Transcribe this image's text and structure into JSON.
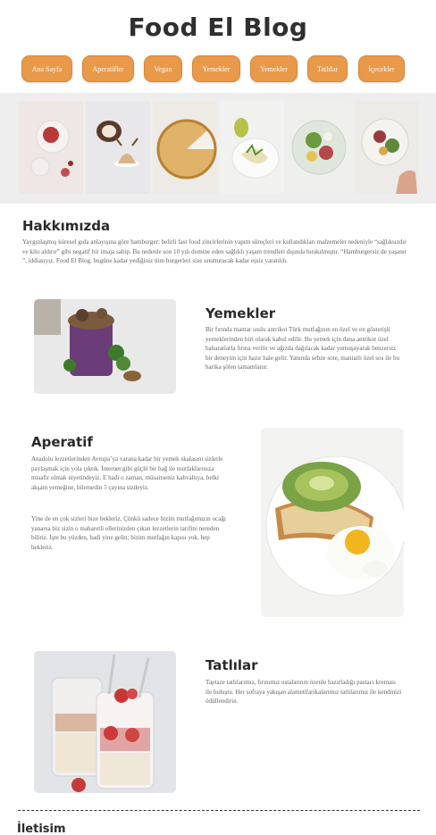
{
  "header": {
    "title": "Food El Blog"
  },
  "nav": {
    "items": [
      {
        "label": "Ana Sayfa"
      },
      {
        "label": "Aperatifler"
      },
      {
        "label": "Vegan"
      },
      {
        "label": "Yemekler"
      },
      {
        "label": "Yemekler"
      },
      {
        "label": "Tatlılar"
      },
      {
        "label": "İçecekler"
      }
    ]
  },
  "about": {
    "heading": "Hakkımızda",
    "text": "Yaygınlaşmış küresel gıda anlayışına göre hamburger; belirli fast food zincirlerinin yapım süreçleri ve kullandıkları malzemeler nedeniyle “sağlıksızdır ve kilo aldırır” gibi negatif bir imaja sahip. Bu nedenle son 10 yılı domine eden sağlıklı yaşam trendleri dışında bırakılmıştır. “Hamburgersiz de yaşanır ”, iddiasıyız. Food El Blog, bugüne kadar yediğiniz tüm burgerleri size unutturacak kadar eşsiz yaratıldı."
  },
  "sections": {
    "meals": {
      "heading": "Yemekler",
      "text": "Bir fırında mantar soslu antrikot Türk mutfağının en özel ve en gösterişli yemeklerinden biri olarak kabul edilir. Bu yemek için dana antrikot özel baharatlarla fırına verilir ve ağızda dağılacak kadar yumuşayarak benzersiz bir deneyim için hazır hale gelir. Yanında sebze sote, mantarlı özel sos ile bu harika şölen tamamlanır."
    },
    "appetizer": {
      "heading": "Aperatif",
      "text1": "Anadolu lezzetlerinden Avrupa’ya varana kadar bir yemek skalasını sizlerle paylaşmak için yola çıktık. İnternet gibi güçlü bir bağ ile mutfaklarınıza misafir olmak niyetindeyiz. E hadi o zaman, müsaitseniz kahvaltıya, belki akşam yemeğine, bilemedin 5 çayına sizdeyiz.",
      "text2": "Yine de en çok sizleri bize bekleriz. Çünkü sadece bizim mutfağımızın ocağı yanarsa biz sizin o maharetli ellerinizden çıkan lezzetlerin tarifini nereden biliriz. İşte bu yüzden, hadi yine gelin; bizim mutfağın kapısı yok, hep bekleriz."
    },
    "desserts": {
      "heading": "Tatlılar",
      "text": "Taptaze tatlılarımız, fırınımız ustalarının özenle hazırladığı pastacı kreması ile buluştu. Her sofraya yakışan alametifarikalarımız tatlılarımız ile kendinizi ödüllendirin."
    }
  },
  "footer": {
    "contact_heading": "İletisim"
  },
  "colors": {
    "nav_button": "#e8994a",
    "gallery_bg": "#efeeee"
  }
}
